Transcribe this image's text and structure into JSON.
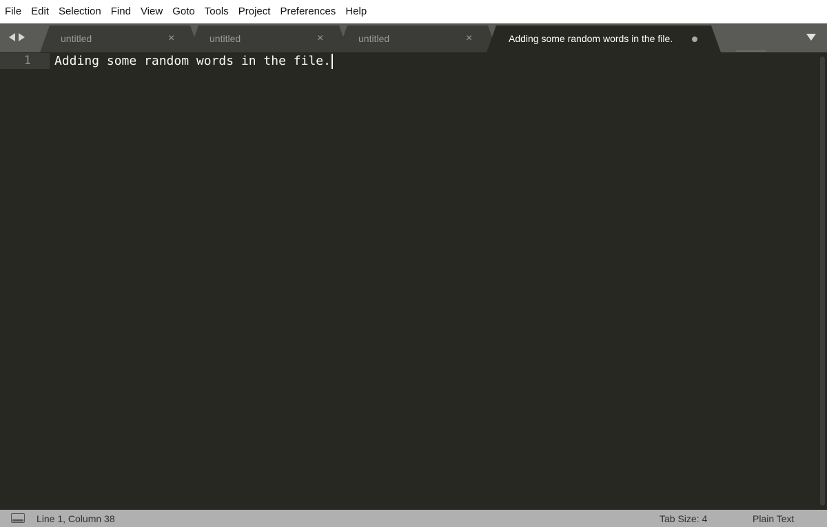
{
  "menu": {
    "items": [
      "File",
      "Edit",
      "Selection",
      "Find",
      "View",
      "Goto",
      "Tools",
      "Project",
      "Preferences",
      "Help"
    ]
  },
  "tabs": [
    {
      "label": "untitled",
      "close": "×"
    },
    {
      "label": "untitled",
      "close": "×"
    },
    {
      "label": "untitled",
      "close": "×"
    },
    {
      "label": "Adding some random words in the file.",
      "active": true,
      "dirty": true
    }
  ],
  "editor": {
    "lines": [
      {
        "number": "1",
        "text": "Adding some random words in the file."
      }
    ]
  },
  "status": {
    "position": "Line 1, Column 38",
    "tab_size": "Tab Size: 4",
    "syntax": "Plain Text"
  },
  "colors": {
    "editor_background": "#272822",
    "tabbar_background": "#5a5b57",
    "active_tab": "#272822",
    "inactive_tab": "#3b3c37",
    "statusbar_background": "#b0b0b0"
  },
  "icons": {
    "nav_back": "triangle-left-icon",
    "nav_forward": "triangle-right-icon",
    "tab_close": "close-icon",
    "tab_dirty": "dot-icon",
    "tab_list": "chevron-down-icon",
    "panel_toggle": "panel-icon"
  }
}
